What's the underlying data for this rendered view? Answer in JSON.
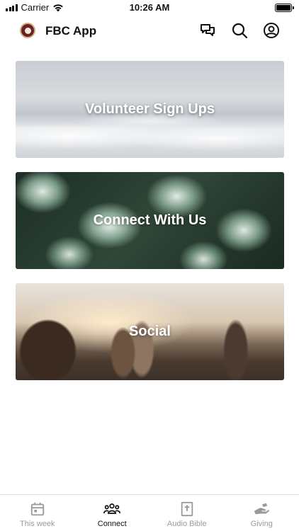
{
  "status_bar": {
    "carrier": "Carrier",
    "time": "10:26 AM"
  },
  "header": {
    "title": "FBC App"
  },
  "cards": [
    {
      "label": "Volunteer Sign Ups"
    },
    {
      "label": "Connect With Us"
    },
    {
      "label": "Social"
    }
  ],
  "tabs": [
    {
      "label": "This week",
      "icon": "calendar-icon",
      "active": false
    },
    {
      "label": "Connect",
      "icon": "people-icon",
      "active": true
    },
    {
      "label": "Audio Bible",
      "icon": "bible-icon",
      "active": false
    },
    {
      "label": "Giving",
      "icon": "giving-hand-icon",
      "active": false
    }
  ],
  "colors": {
    "active_tab": "#111111",
    "inactive_tab": "#9a9a9a",
    "logo": "#6b1f27"
  }
}
